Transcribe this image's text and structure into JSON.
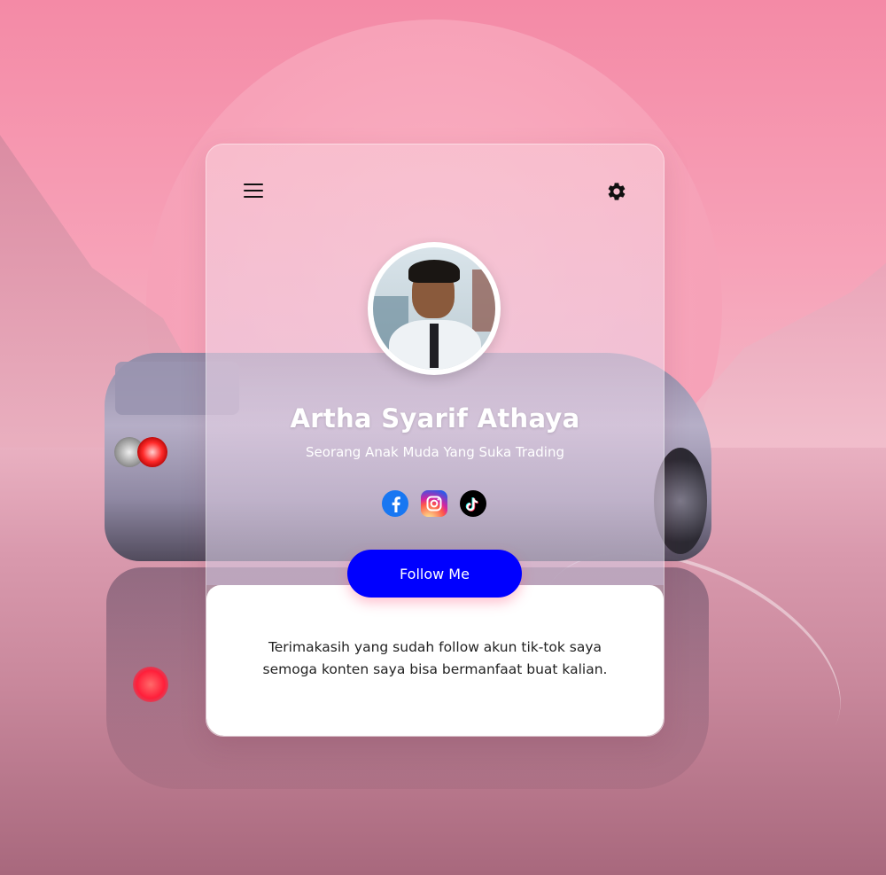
{
  "profile": {
    "name": "Artha Syarif Athaya",
    "bio": "Seorang Anak Muda Yang Suka Trading"
  },
  "socials": [
    {
      "icon": "facebook-icon",
      "color": "#1877f2"
    },
    {
      "icon": "instagram-icon",
      "color": "#d6249f"
    },
    {
      "icon": "tiktok-icon",
      "color": "#000000"
    }
  ],
  "actions": {
    "follow_label": "Follow Me"
  },
  "message": {
    "line1": "Terimakasih yang sudah follow akun tik-tok saya",
    "line2": "semoga konten saya bisa bermanfaat buat kalian."
  },
  "colors": {
    "accent": "#0000ff",
    "background": "#f48aa6"
  }
}
